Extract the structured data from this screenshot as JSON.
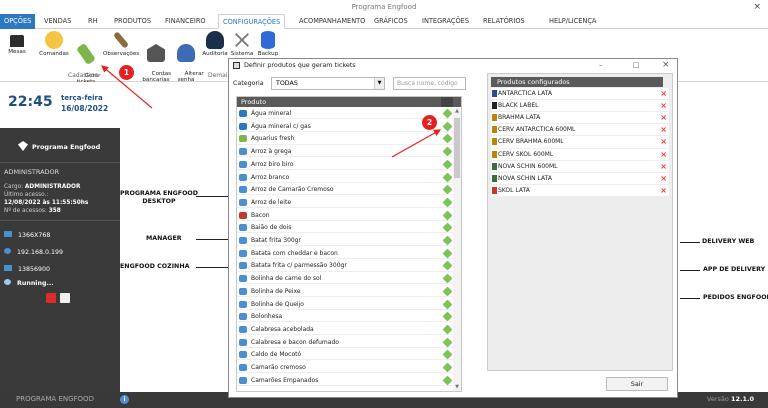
{
  "window": {
    "title": "Programa Engfood",
    "close": "×"
  },
  "menu": [
    "OPÇÕES",
    "VENDAS",
    "RH",
    "PRODUTOS",
    "FINANCEIRO",
    "CONFIGURAÇÕES",
    "ACOMPANHAMENTO",
    "GRÁFICOS",
    "INTEGRAÇÕES",
    "RELATÓRIOS",
    "HELP/LICENÇA"
  ],
  "ribbon": {
    "items": [
      {
        "label": "Mesas",
        "icon": "table-icon"
      },
      {
        "label": "Comandas",
        "icon": "coin-icon"
      },
      {
        "label": "Gerar\ntickets",
        "icon": "ticket-icon"
      },
      {
        "label": "Observações",
        "icon": "broom-icon"
      },
      {
        "label": "Contas\nbancarias",
        "icon": "bank-icon"
      },
      {
        "label": "Alterar\nsenha",
        "icon": "user-key-icon"
      },
      {
        "label": "Auditoria",
        "icon": "user-suit-icon"
      },
      {
        "label": "Sistema",
        "icon": "tools-icon"
      },
      {
        "label": "Backup",
        "icon": "database-icon"
      }
    ],
    "group_cadastros": "Cadastros",
    "group_demais": "Demai"
  },
  "sidebar": {
    "time": "22:45",
    "weekday": "terça-feira",
    "date": "16/08/2022",
    "logo_text": "Programa Engfood",
    "section": "ADMINISTRADOR",
    "cargo_label": "Cargo:",
    "cargo_value": "ADMINISTRADOR",
    "ultimo_label": "Último acesso.:",
    "ultimo_value": "12/08/2022 às 11:55:50hs",
    "acessos_label": "Nº de acessos:",
    "acessos_value": "358",
    "resolution": "1366X768",
    "ip": "192.168.0.199",
    "code": "13856900",
    "status": "Running..."
  },
  "annotations": {
    "programa": "PROGRAMA ENGFOOD\nDESKTOP",
    "manager": "MANAGER",
    "cozinha": "ENGFOOD COZINHA",
    "delivery_web": "DELIVERY WEB",
    "app_delivery": "APP DE DELIVERY",
    "pedidos": "PEDIDOS ENGFOOD",
    "badge1": "1",
    "badge2": "2"
  },
  "dialog": {
    "title": "Definir produtos que geram tickets",
    "category_label": "Categoria",
    "category_value": "TODAS",
    "search_placeholder": "Busca nome, código",
    "list_header": "Produto",
    "products": [
      "Água mineral",
      "Água mineral c/ gas",
      "Aquarius fresh",
      "Arroz à grega",
      "Arroz biro biro",
      "Arroz branco",
      "Arroz de Camarão Cremoso",
      "Arroz de leite",
      "Bacon",
      "Baião de dois",
      "Batat frita 300gr",
      "Batata com cheddar e bacon",
      "Batata frita c/ parmessão 300gr",
      "Bolinha de carne do sol",
      "Bolinha de Peixe",
      "Bolinha de Queijo",
      "Bolonhesa",
      "Calabresa acebolada",
      "Calabresa e bacon defumado",
      "Caldo de Mocotó",
      "Camarão cremoso",
      "Camarões Empanados"
    ],
    "configured_header": "Produtos configurados",
    "configured": [
      "ANTARCTICA LATA",
      "BLACK LABEL",
      "BRAHMA LATA",
      "CERV ANTARCTICA 600ML",
      "CERV BRAHMA 600ML",
      "CERV SKOL 600ML",
      "NOVA SCHIN 600ML",
      "NOVA SCHIN LATA",
      "SKOL LATA"
    ],
    "sair": "Sair",
    "win_min": "–",
    "win_max": "□",
    "win_close": "×"
  },
  "footer": {
    "left": "PROGRAMA ENGFOOD",
    "info": "i",
    "version_label": "Versão",
    "version": "12.1.0"
  },
  "colors": {
    "accent": "#2b79c2",
    "sidebar": "#3a3a3a",
    "delete": "#e53935",
    "badge": "#e62020"
  }
}
